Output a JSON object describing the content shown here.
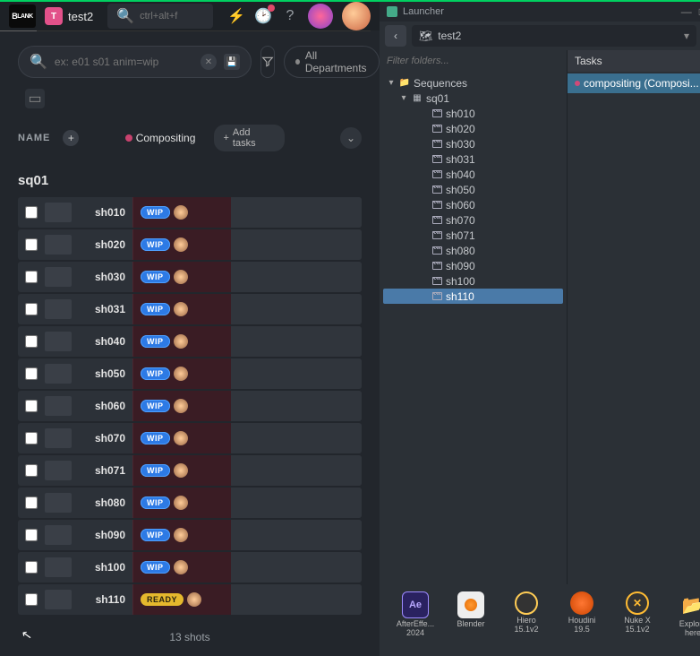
{
  "left": {
    "project": {
      "initial": "T",
      "name": "test2"
    },
    "topSearch": {
      "placeholder": "ctrl+alt+f"
    },
    "filterSearch": {
      "placeholder": "ex: e01 s01 anim=wip"
    },
    "departments": "All Departments",
    "columns": {
      "name": "NAME",
      "comp": "Compositing",
      "addTasks": "Add tasks"
    },
    "sequence": "sq01",
    "rows": [
      {
        "name": "sh010",
        "status": "WIP",
        "statusClass": "status-wip"
      },
      {
        "name": "sh020",
        "status": "WIP",
        "statusClass": "status-wip"
      },
      {
        "name": "sh030",
        "status": "WIP",
        "statusClass": "status-wip"
      },
      {
        "name": "sh031",
        "status": "WIP",
        "statusClass": "status-wip"
      },
      {
        "name": "sh040",
        "status": "WIP",
        "statusClass": "status-wip"
      },
      {
        "name": "sh050",
        "status": "WIP",
        "statusClass": "status-wip"
      },
      {
        "name": "sh060",
        "status": "WIP",
        "statusClass": "status-wip"
      },
      {
        "name": "sh070",
        "status": "WIP",
        "statusClass": "status-wip"
      },
      {
        "name": "sh071",
        "status": "WIP",
        "statusClass": "status-wip"
      },
      {
        "name": "sh080",
        "status": "WIP",
        "statusClass": "status-wip"
      },
      {
        "name": "sh090",
        "status": "WIP",
        "statusClass": "status-wip"
      },
      {
        "name": "sh100",
        "status": "WIP",
        "statusClass": "status-wip"
      },
      {
        "name": "sh110",
        "status": "READY",
        "statusClass": "status-ready"
      }
    ],
    "footer": "13 shots"
  },
  "right": {
    "title": "Launcher",
    "crumb": "test2",
    "treeFilter": {
      "placeholder": "Filter folders..."
    },
    "tree": {
      "root": "Sequences",
      "seq": "sq01",
      "shots": [
        "sh010",
        "sh020",
        "sh030",
        "sh031",
        "sh040",
        "sh050",
        "sh060",
        "sh070",
        "sh071",
        "sh080",
        "sh090",
        "sh100",
        "sh110"
      ],
      "selected": "sh110"
    },
    "tasksHeader": "Tasks",
    "task": "compositing (Composi...",
    "apps": [
      {
        "label": "AfterEffe...\n2024",
        "icon": "ic-ae",
        "text": "Ae"
      },
      {
        "label": "Blender",
        "icon": "ic-bl",
        "text": ""
      },
      {
        "label": "Hiero\n15.1v2",
        "icon": "ic-hi",
        "text": ""
      },
      {
        "label": "Houdini\n19.5",
        "icon": "ic-ho",
        "text": ""
      },
      {
        "label": "Nuke X\n15.1v2",
        "icon": "ic-nk",
        "text": ""
      },
      {
        "label": "Explore\nhere",
        "icon": "ic-ex",
        "text": "📂"
      }
    ]
  }
}
